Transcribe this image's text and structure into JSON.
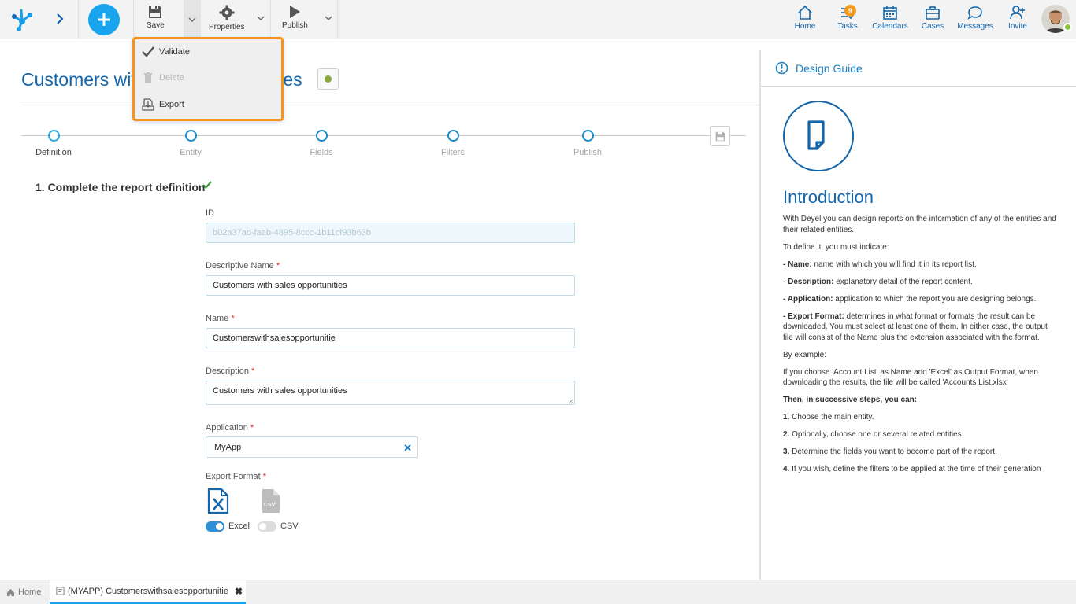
{
  "toolbar": {
    "save_label": "Save",
    "properties_label": "Properties",
    "publish_label": "Publish",
    "right_items": [
      {
        "label": "Home",
        "icon": "home-icon"
      },
      {
        "label": "Tasks",
        "icon": "tasks-icon",
        "badge": "9"
      },
      {
        "label": "Calendars",
        "icon": "calendar-icon"
      },
      {
        "label": "Cases",
        "icon": "briefcase-icon"
      },
      {
        "label": "Messages",
        "icon": "message-icon"
      },
      {
        "label": "Invite",
        "icon": "invite-icon"
      }
    ]
  },
  "dropdown": {
    "items": [
      {
        "label": "Validate",
        "icon": "check-icon",
        "enabled": true
      },
      {
        "label": "Delete",
        "icon": "trash-icon",
        "enabled": false
      },
      {
        "label": "Export",
        "icon": "export-icon",
        "enabled": true
      }
    ]
  },
  "page": {
    "title": "Customers with sales opportunities",
    "status_color": "#8aa83c"
  },
  "steps": [
    {
      "label": "Definition",
      "current": true
    },
    {
      "label": "Entity",
      "current": false
    },
    {
      "label": "Fields",
      "current": false
    },
    {
      "label": "Filters",
      "current": false
    },
    {
      "label": "Publish",
      "current": false
    }
  ],
  "section": {
    "title": "1. Complete the report definition"
  },
  "form": {
    "id_label": "ID",
    "id_value": "b02a37ad-faab-4895-8ccc-1b11cf93b63b",
    "descriptive_name_label": "Descriptive Name",
    "descriptive_name_value": "Customers with sales opportunities",
    "name_label": "Name",
    "name_value": "Customerswithsalesopportunitie",
    "description_label": "Description",
    "description_value": "Customers with sales opportunities",
    "application_label": "Application",
    "application_value": "MyApp",
    "export_format_label": "Export Format",
    "required_mark": "*",
    "formats": [
      {
        "label": "Excel",
        "enabled": true
      },
      {
        "label": "CSV",
        "enabled": false
      }
    ]
  },
  "guide": {
    "header": "Design Guide",
    "intro_title": "Introduction",
    "p1": "With Deyel you can design reports on the information of any of the entities and their related entities.",
    "p2": "To define it, you must indicate:",
    "name_term": "- Name:",
    "name_text": " name with which you will find it in its report list.",
    "desc_term": "- Description:",
    "desc_text": " explanatory detail of the report content.",
    "app_term": "- Application:",
    "app_text": " application to which the report you are designing belongs.",
    "export_term": "- Export Format:",
    "export_text": " determines in what format or formats the result can be downloaded. You must select at least one of them. In either case, the output file will consist of the Name plus the extension associated with the format.",
    "p_example": "By example:",
    "p_example_text": "If you choose 'Account List' as Name and 'Excel' as Output Format, when downloading the results, the file will be called 'Accounts List.xlsx'",
    "p_then": "Then, in successive steps, you can:",
    "s1_num": "1.",
    "s1_text": " Choose the main entity.",
    "s2_num": "2.",
    "s2_text": " Optionally, choose one or several related entities.",
    "s3_num": "3.",
    "s3_text": " Determine the fields you want to become part of the report.",
    "s4_num": "4.",
    "s4_text": " If you wish, define the filters to be applied at the time of their generation"
  },
  "bottom_tabs": {
    "home_label": "Home",
    "active_label": "(MYAPP) Customerswithsalesopportunitie"
  },
  "colors": {
    "accent": "#19a4ee",
    "brand_blue": "#1465a9",
    "dropdown_border": "#f5951f",
    "badge": "#f39a1d",
    "online": "#8ac43f"
  }
}
